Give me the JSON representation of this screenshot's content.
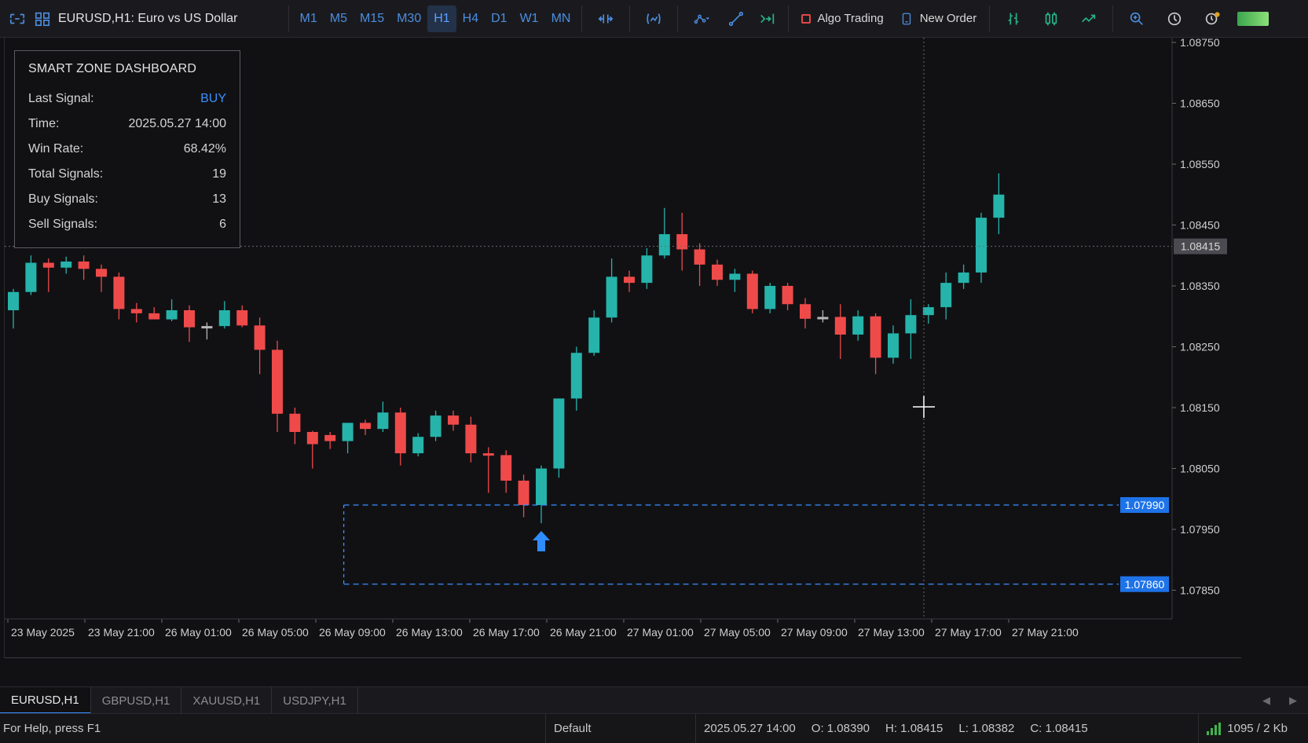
{
  "toolbar": {
    "symbol_title": "EURUSD,H1:  Euro vs US Dollar",
    "timeframes": [
      "M1",
      "M5",
      "M15",
      "M30",
      "H1",
      "H4",
      "D1",
      "W1",
      "MN"
    ],
    "active_timeframe": "H1",
    "algo_trading": "Algo Trading",
    "new_order": "New Order"
  },
  "dashboard": {
    "title": "SMART ZONE DASHBOARD",
    "rows": [
      {
        "label": "Last Signal:",
        "value": "BUY"
      },
      {
        "label": "Time:",
        "value": "2025.05.27 14:00"
      },
      {
        "label": "Win Rate:",
        "value": "68.42%"
      },
      {
        "label": "Total Signals:",
        "value": "19"
      },
      {
        "label": "Buy Signals:",
        "value": "13"
      },
      {
        "label": "Sell Signals:",
        "value": "6"
      }
    ]
  },
  "chart_data": {
    "type": "candlestick",
    "symbol": "EURUSD",
    "timeframe": "H1",
    "ylim": [
      1.078,
      1.088
    ],
    "y_ticks": [
      "1.08750",
      "1.08650",
      "1.08550",
      "1.08450",
      "1.08350",
      "1.08250",
      "1.08150",
      "1.08050",
      "1.07950",
      "1.07850"
    ],
    "x_labels": [
      "23 May 2025",
      "23 May 21:00",
      "26 May 01:00",
      "26 May 05:00",
      "26 May 09:00",
      "26 May 13:00",
      "26 May 17:00",
      "26 May 21:00",
      "27 May 01:00",
      "27 May 05:00",
      "27 May 09:00",
      "27 May 13:00",
      "27 May 17:00",
      "27 May 21:00"
    ],
    "current_price": "1.08415",
    "zone_top": "1.07990",
    "zone_bottom": "1.07860",
    "colors": {
      "bull": "#26b3aa",
      "bear": "#ef4a4a",
      "doji": "#b8b8b8",
      "zone": "#3a8fff",
      "grid": "#2a2a30"
    },
    "candles": [
      {
        "o": 1.0831,
        "h": 1.08345,
        "l": 1.0828,
        "c": 1.0834
      },
      {
        "o": 1.0834,
        "h": 1.084,
        "l": 1.08335,
        "c": 1.08388
      },
      {
        "o": 1.08388,
        "h": 1.08395,
        "l": 1.0834,
        "c": 1.0838
      },
      {
        "o": 1.0838,
        "h": 1.08398,
        "l": 1.0837,
        "c": 1.0839
      },
      {
        "o": 1.0839,
        "h": 1.084,
        "l": 1.0836,
        "c": 1.08378
      },
      {
        "o": 1.08378,
        "h": 1.08385,
        "l": 1.0834,
        "c": 1.08365
      },
      {
        "o": 1.08365,
        "h": 1.08372,
        "l": 1.08295,
        "c": 1.08312
      },
      {
        "o": 1.08312,
        "h": 1.08322,
        "l": 1.0829,
        "c": 1.08305
      },
      {
        "o": 1.08305,
        "h": 1.08315,
        "l": 1.08295,
        "c": 1.08295
      },
      {
        "o": 1.08295,
        "h": 1.08328,
        "l": 1.08292,
        "c": 1.0831
      },
      {
        "o": 1.0831,
        "h": 1.08318,
        "l": 1.08258,
        "c": 1.08282
      },
      {
        "o": 1.08282,
        "h": 1.0829,
        "l": 1.08262,
        "c": 1.08284
      },
      {
        "o": 1.08284,
        "h": 1.08325,
        "l": 1.0828,
        "c": 1.0831
      },
      {
        "o": 1.0831,
        "h": 1.08318,
        "l": 1.08282,
        "c": 1.08285
      },
      {
        "o": 1.08285,
        "h": 1.08298,
        "l": 1.08205,
        "c": 1.08245
      },
      {
        "o": 1.08245,
        "h": 1.0826,
        "l": 1.0811,
        "c": 1.0814
      },
      {
        "o": 1.0814,
        "h": 1.0815,
        "l": 1.0809,
        "c": 1.0811
      },
      {
        "o": 1.0811,
        "h": 1.08112,
        "l": 1.0805,
        "c": 1.0809
      },
      {
        "o": 1.08105,
        "h": 1.0811,
        "l": 1.08082,
        "c": 1.08095
      },
      {
        "o": 1.08095,
        "h": 1.08125,
        "l": 1.08075,
        "c": 1.08125
      },
      {
        "o": 1.08125,
        "h": 1.0813,
        "l": 1.08105,
        "c": 1.08115
      },
      {
        "o": 1.08115,
        "h": 1.0816,
        "l": 1.0811,
        "c": 1.08142
      },
      {
        "o": 1.08142,
        "h": 1.0815,
        "l": 1.08055,
        "c": 1.08075
      },
      {
        "o": 1.08075,
        "h": 1.08108,
        "l": 1.0807,
        "c": 1.08102
      },
      {
        "o": 1.08102,
        "h": 1.08145,
        "l": 1.08095,
        "c": 1.08137
      },
      {
        "o": 1.08137,
        "h": 1.08145,
        "l": 1.08112,
        "c": 1.08122
      },
      {
        "o": 1.08122,
        "h": 1.08135,
        "l": 1.0806,
        "c": 1.08075
      },
      {
        "o": 1.08075,
        "h": 1.08085,
        "l": 1.0801,
        "c": 1.08072
      },
      {
        "o": 1.08072,
        "h": 1.0808,
        "l": 1.0801,
        "c": 1.0803
      },
      {
        "o": 1.0803,
        "h": 1.0804,
        "l": 1.0797,
        "c": 1.0799
      },
      {
        "o": 1.0799,
        "h": 1.08055,
        "l": 1.0796,
        "c": 1.0805
      },
      {
        "o": 1.0805,
        "h": 1.08165,
        "l": 1.08035,
        "c": 1.08165
      },
      {
        "o": 1.08165,
        "h": 1.0825,
        "l": 1.08145,
        "c": 1.0824
      },
      {
        "o": 1.0824,
        "h": 1.0831,
        "l": 1.08235,
        "c": 1.08298
      },
      {
        "o": 1.08298,
        "h": 1.08395,
        "l": 1.0829,
        "c": 1.08365
      },
      {
        "o": 1.08365,
        "h": 1.08375,
        "l": 1.0834,
        "c": 1.08355
      },
      {
        "o": 1.08355,
        "h": 1.08412,
        "l": 1.08345,
        "c": 1.084
      },
      {
        "o": 1.084,
        "h": 1.08478,
        "l": 1.08395,
        "c": 1.08435
      },
      {
        "o": 1.08435,
        "h": 1.0847,
        "l": 1.08375,
        "c": 1.0841
      },
      {
        "o": 1.0841,
        "h": 1.0842,
        "l": 1.0835,
        "c": 1.08385
      },
      {
        "o": 1.08385,
        "h": 1.08393,
        "l": 1.0835,
        "c": 1.0836
      },
      {
        "o": 1.0836,
        "h": 1.08378,
        "l": 1.0834,
        "c": 1.0837
      },
      {
        "o": 1.0837,
        "h": 1.08375,
        "l": 1.08305,
        "c": 1.08312
      },
      {
        "o": 1.08312,
        "h": 1.08355,
        "l": 1.08305,
        "c": 1.0835
      },
      {
        "o": 1.0835,
        "h": 1.08355,
        "l": 1.0831,
        "c": 1.0832
      },
      {
        "o": 1.0832,
        "h": 1.0833,
        "l": 1.0828,
        "c": 1.08296
      },
      {
        "o": 1.08296,
        "h": 1.0831,
        "l": 1.0829,
        "c": 1.08299
      },
      {
        "o": 1.08299,
        "h": 1.0832,
        "l": 1.0823,
        "c": 1.0827
      },
      {
        "o": 1.0827,
        "h": 1.0831,
        "l": 1.0826,
        "c": 1.083
      },
      {
        "o": 1.083,
        "h": 1.08305,
        "l": 1.08205,
        "c": 1.08232
      },
      {
        "o": 1.08232,
        "h": 1.08285,
        "l": 1.08222,
        "c": 1.08272
      },
      {
        "o": 1.08272,
        "h": 1.08328,
        "l": 1.0823,
        "c": 1.08302
      },
      {
        "o": 1.08302,
        "h": 1.0832,
        "l": 1.08288,
        "c": 1.08315
      },
      {
        "o": 1.08315,
        "h": 1.08372,
        "l": 1.08295,
        "c": 1.08355
      },
      {
        "o": 1.08355,
        "h": 1.08385,
        "l": 1.08345,
        "c": 1.08372
      },
      {
        "o": 1.08372,
        "h": 1.0847,
        "l": 1.08355,
        "c": 1.08462
      },
      {
        "o": 1.08462,
        "h": 1.08535,
        "l": 1.08435,
        "c": 1.085
      }
    ]
  },
  "tabs": [
    "EURUSD,H1",
    "GBPUSD,H1",
    "XAUUSD,H1",
    "USDJPY,H1"
  ],
  "status": {
    "help": "For Help, press F1",
    "profile": "Default",
    "time": "2025.05.27 14:00",
    "open": "O: 1.08390",
    "high": "H: 1.08415",
    "low": "L: 1.08382",
    "close": "C: 1.08415",
    "traffic": "1095 / 2 Kb"
  }
}
